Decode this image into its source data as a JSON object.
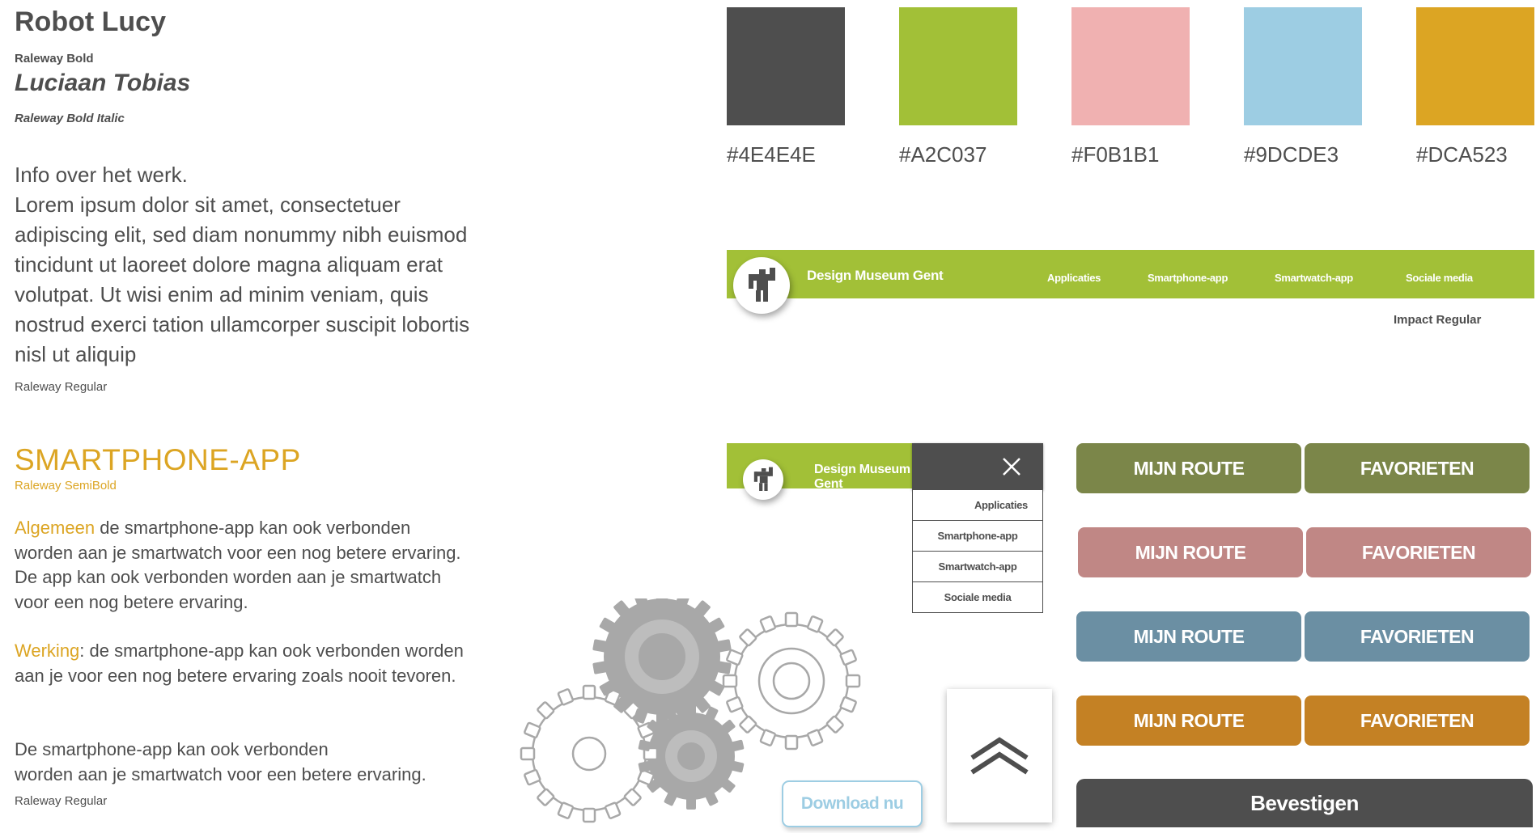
{
  "typography": {
    "title": "Robot Lucy",
    "title_font": "Raleway Bold",
    "subtitle": "Luciaan Tobias",
    "subtitle_font": "Raleway Bold Italic",
    "body_intro": "Info over het werk.",
    "body_text": "Lorem ipsum dolor sit amet, consectetuer adipiscing elit, sed diam nonummy nibh euismod tincidunt ut laoreet dolore magna aliquam erat volutpat. Ut wisi enim ad minim veniam, quis nostrud exerci tation ullamcorper suscipit lobortis nisl ut aliquip",
    "body_font": "Raleway Regular"
  },
  "section": {
    "heading": "SMARTPHONE-APP",
    "heading_font": "Raleway SemiBold",
    "p1_highlight": "Algemeen",
    "p1_text": " de smartphone-app kan ook verbonden worden aan je smartwatch voor een nog betere ervaring. De app kan ook verbonden worden aan je smartwatch voor een nog betere ervaring.",
    "p2_highlight": "Werking",
    "p2_text": ": de smartphone-app kan ook verbonden worden aan je voor een nog betere ervaring zoals nooit tevoren.",
    "p3_line1": "De smartphone-app kan ook verbonden",
    "p3_line2": "worden aan je smartwatch voor een betere ervaring.",
    "footer_font": "Raleway Regular"
  },
  "palette": [
    {
      "hex": "#4E4E4E"
    },
    {
      "hex": "#A2C037"
    },
    {
      "hex": "#F0B1B1"
    },
    {
      "hex": "#9DCDE3"
    },
    {
      "hex": "#DCA523"
    }
  ],
  "palette_labels": [
    "#4E4E4E",
    "#A2C037",
    "#F0B1B1",
    "#9DCDE3",
    "#DCA523"
  ],
  "navbar": {
    "brand": "Design Museum Gent",
    "links": [
      "Applicaties",
      "Smartphone-app",
      "Smartwatch-app",
      "Sociale media"
    ],
    "font_caption": "Impact Regular",
    "logo_icon": "robot-icon"
  },
  "mobile_nav": {
    "brand": "Design Museum Gent",
    "close_icon": "close-icon",
    "menu": [
      "Applicaties",
      "Smartphone-app",
      "Smartwatch-app",
      "Sociale media"
    ]
  },
  "buttons": {
    "route": "MIJN ROUTE",
    "favorites": "FAVORIETEN",
    "confirm": "Bevestigen",
    "download": "Download nu",
    "scroll_icon": "chevron-up-icon",
    "colors": {
      "green": "#7B8649",
      "pink": "#C08785",
      "blue": "#6B8FA3",
      "orange": "#C48124"
    }
  },
  "decoration": {
    "icon": "gears-icon"
  }
}
